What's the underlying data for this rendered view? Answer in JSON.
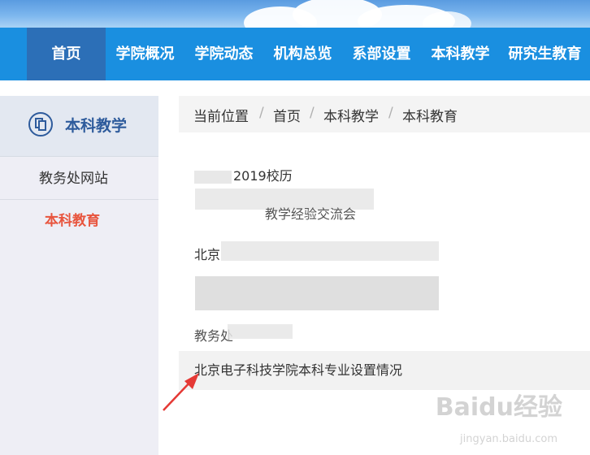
{
  "nav": {
    "items": [
      {
        "label": "首页",
        "active": true
      },
      {
        "label": "学院概况",
        "active": false
      },
      {
        "label": "学院动态",
        "active": false
      },
      {
        "label": "机构总览",
        "active": false
      },
      {
        "label": "系部设置",
        "active": false
      },
      {
        "label": "本科教学",
        "active": false
      },
      {
        "label": "研究生教育",
        "active": false
      }
    ],
    "color": "#1a8fe0",
    "active_color": "#2c6fb7"
  },
  "sidebar": {
    "title": "本科教学",
    "icon": "copy-icon",
    "items": [
      {
        "label": "教务处网站",
        "current": false
      },
      {
        "label": "本科教育",
        "current": true
      }
    ],
    "current_color": "#e8553e"
  },
  "breadcrumb": {
    "location_label": "当前位置",
    "items": [
      "首页",
      "本科教学",
      "本科教育"
    ],
    "separator": "/"
  },
  "list": {
    "items": [
      "2019校历",
      "北京电子科技学院本科专业设置情况"
    ],
    "partial_fragments": [
      "北京",
      "教务处",
      "教学经验交流会"
    ]
  },
  "watermark": {
    "text": "Baidu经验",
    "sub": "jingyan.baidu.com"
  }
}
